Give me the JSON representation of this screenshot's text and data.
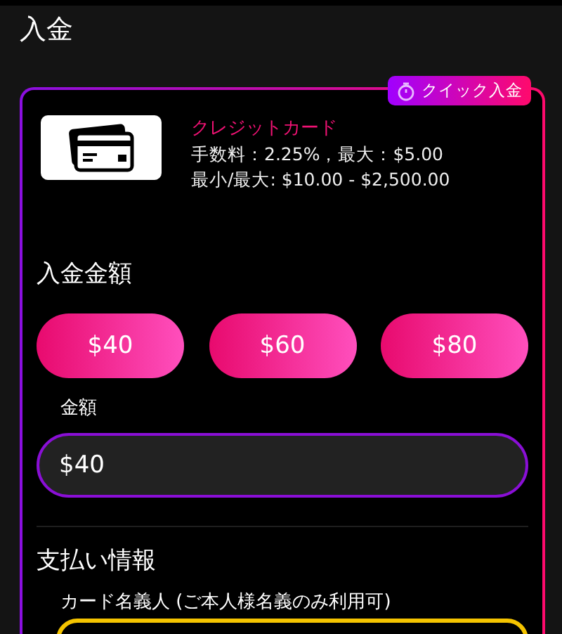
{
  "page_title": "入金",
  "method": {
    "badge": "クイック入金",
    "name": "クレジットカード",
    "fee": "手数料：2.25%，最大：$5.00",
    "limits": "最小/最大: $10.00 - $2,500.00"
  },
  "amount_section": {
    "heading": "入金金額",
    "presets": [
      "$40",
      "$60",
      "$80"
    ],
    "field_label": "金額",
    "value": "$40"
  },
  "payment_section": {
    "heading": "支払い情報",
    "field_label": "カード名義人 (ご本人様名義のみ利用可)"
  }
}
